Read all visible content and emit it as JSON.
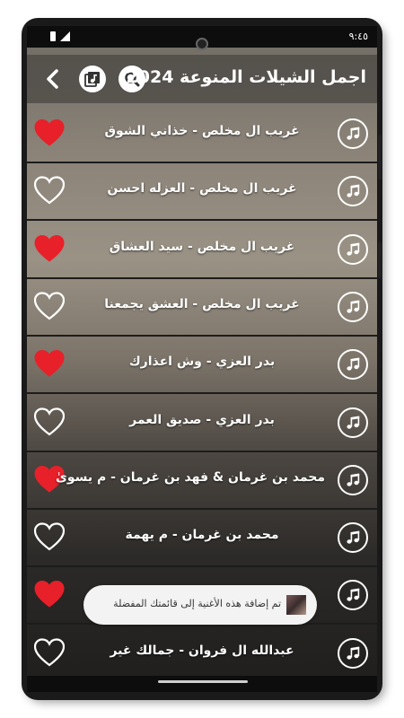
{
  "status": {
    "time": "٩:٤٥"
  },
  "appbar": {
    "title": "اجمل الشيلات المنوعة 2024",
    "icons": [
      "search-icon",
      "playlist-icon",
      "back-arrow-icon"
    ]
  },
  "songs": [
    {
      "title": "غريب ال مخلص - خذاني الشوق",
      "favorite": true
    },
    {
      "title": "غريب ال مخلص - العزله احسن",
      "favorite": false
    },
    {
      "title": "غريب ال مخلص - سيد العشاق",
      "favorite": true
    },
    {
      "title": "غريب ال مخلص - العشق يجمعنا",
      "favorite": false
    },
    {
      "title": "بدر العزي - وش اعذارك",
      "favorite": true
    },
    {
      "title": "بدر العزي - صديق العمر",
      "favorite": false
    },
    {
      "title": "محمد بن غرمان & فهد بن غرمان - م يسوىٰ",
      "favorite": true
    },
    {
      "title": "محمد بن غرمان - م يهمة",
      "favorite": false
    },
    {
      "title": "",
      "favorite": true
    },
    {
      "title": "عبدالله ال فروان - جمالك غير",
      "favorite": false
    }
  ],
  "toast": {
    "message": "تم إضافة هذه الأغنية إلى قائمتك المفضلة"
  },
  "colors": {
    "heart": "#e8202a",
    "text": "#ffffff"
  }
}
